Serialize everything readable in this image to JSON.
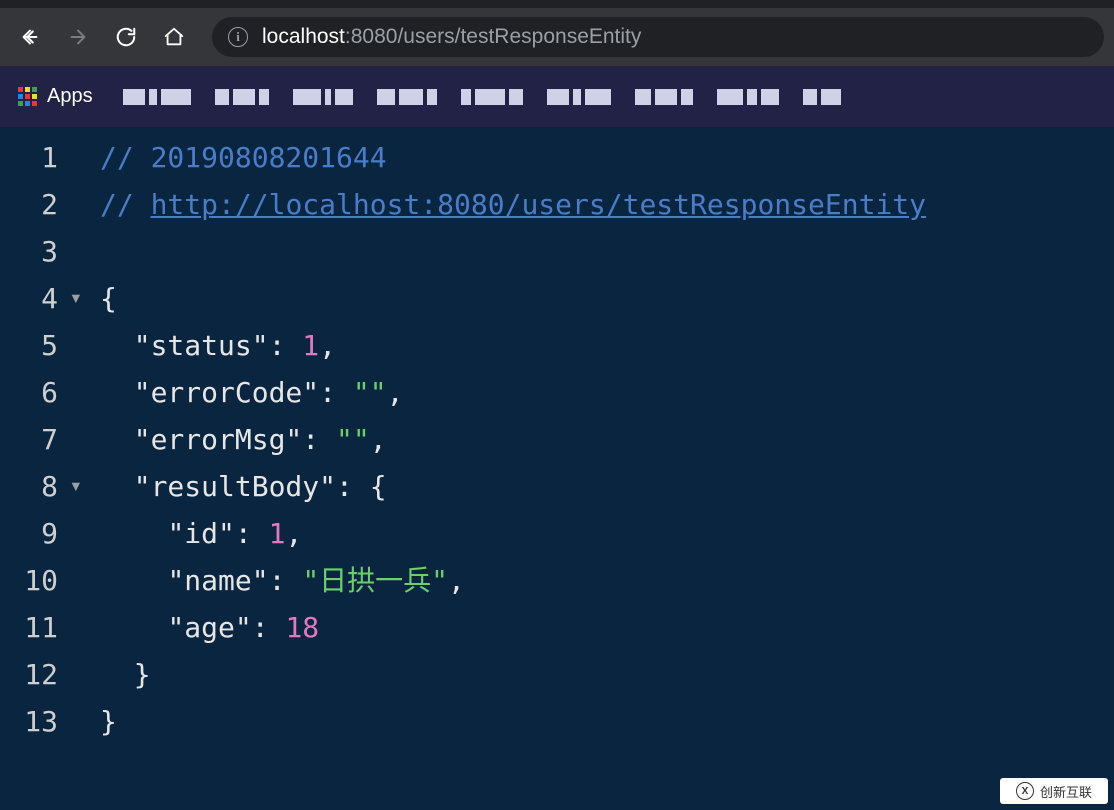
{
  "browser": {
    "url_host": "localhost",
    "url_rest": ":8080/users/testResponseEntity",
    "apps_label": "Apps"
  },
  "code": {
    "lines": [
      1,
      2,
      3,
      4,
      5,
      6,
      7,
      8,
      9,
      10,
      11,
      12,
      13
    ],
    "fold_lines": [
      4,
      8
    ],
    "comment_ts": "// 20190808201644",
    "comment_url_prefix": "// ",
    "comment_url": "http://localhost:8080/users/testResponseEntity",
    "json": {
      "status": 1,
      "errorCode": "",
      "errorMsg": "",
      "resultBody": {
        "id": 1,
        "name": "日拱一兵",
        "age": 18
      }
    },
    "keys": {
      "status": "\"status\"",
      "errorCode": "\"errorCode\"",
      "errorMsg": "\"errorMsg\"",
      "resultBody": "\"resultBody\"",
      "id": "\"id\"",
      "name": "\"name\"",
      "age": "\"age\""
    },
    "display": {
      "status_val": "1",
      "errorCode_val": "\"\"",
      "errorMsg_val": "\"\"",
      "id_val": "1",
      "name_val": "\"日拱一兵\"",
      "age_val": "18"
    }
  },
  "watermark": {
    "text": "创新互联"
  }
}
